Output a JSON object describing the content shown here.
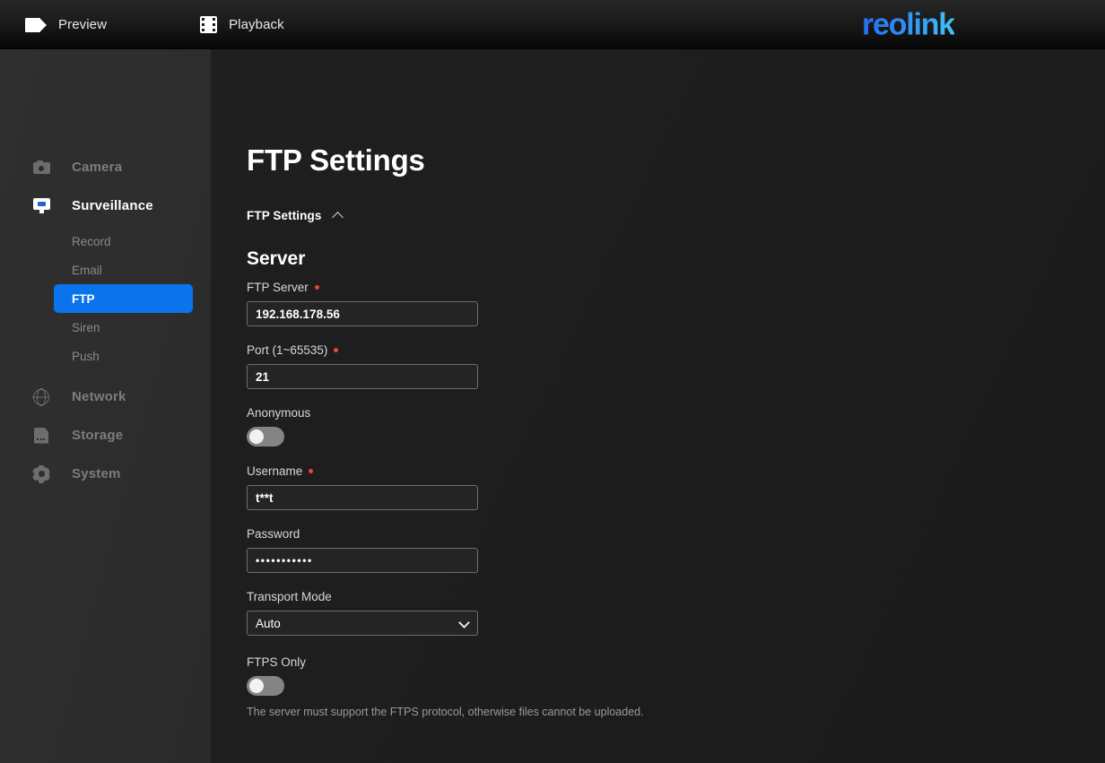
{
  "header": {
    "nav": [
      {
        "label": "Preview",
        "icon": "video-camera-icon"
      },
      {
        "label": "Playback",
        "icon": "film-strip-icon"
      }
    ],
    "logo_text": "reolink",
    "logo_color": "#2f8df6"
  },
  "sidebar": {
    "accent_color": "#0b74ec",
    "items": [
      {
        "label": "Camera",
        "icon": "camera-icon",
        "active": false
      },
      {
        "label": "Surveillance",
        "icon": "monitor-icon",
        "active": true
      },
      {
        "label": "Network",
        "icon": "globe-icon",
        "active": false
      },
      {
        "label": "Storage",
        "icon": "sdcard-icon",
        "active": false
      },
      {
        "label": "System",
        "icon": "gear-icon",
        "active": false
      }
    ],
    "sub_items": [
      {
        "label": "Record",
        "active": false
      },
      {
        "label": "Email",
        "active": false
      },
      {
        "label": "FTP",
        "active": true
      },
      {
        "label": "Siren",
        "active": false
      },
      {
        "label": "Push",
        "active": false
      }
    ]
  },
  "main": {
    "page_title": "FTP Settings",
    "accordion_label": "FTP Settings",
    "accordion_icon": "chevron-up-icon",
    "section_title": "Server",
    "fields": {
      "ftp_server": {
        "label": "FTP Server",
        "required": true,
        "value": "192.168.178.56",
        "placeholder": ""
      },
      "port": {
        "label": "Port (1~65535)",
        "required": true,
        "value": "21",
        "placeholder": ""
      },
      "anonymous": {
        "label": "Anonymous",
        "state": "off"
      },
      "username": {
        "label": "Username",
        "required": true,
        "value": "t**t",
        "placeholder": ""
      },
      "password": {
        "label": "Password",
        "required": false,
        "value": "•••••••••••",
        "placeholder": ""
      },
      "transport_mode": {
        "label": "Transport Mode",
        "value": "Auto",
        "options": [
          "Auto"
        ],
        "icon": "chevron-down-icon"
      },
      "ftps_only": {
        "label": "FTPS Only",
        "state": "off",
        "hint": "The server must support the FTPS protocol, otherwise files cannot be uploaded."
      }
    }
  }
}
